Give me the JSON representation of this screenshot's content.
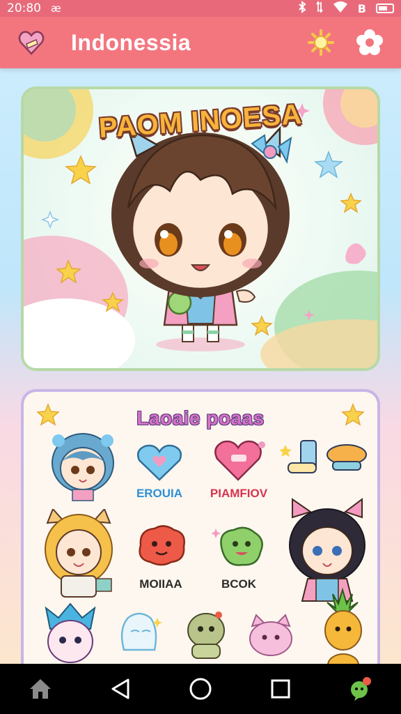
{
  "status_bar": {
    "time": "20:80",
    "notification_glyph": "æ",
    "carrier_glyph": "B"
  },
  "app_bar": {
    "title": "Indonessia",
    "left_icon": "heart-icon",
    "right_icons": [
      "sun-icon",
      "flower-settings-icon"
    ]
  },
  "hero": {
    "title": "PAOM INOESA"
  },
  "gallery": {
    "title": "Laoaie poaas",
    "stickers": [
      {
        "label": "EROUIA"
      },
      {
        "label": "PIAMFIOV"
      },
      {
        "label": "MOIIAA"
      },
      {
        "label": "BCOK"
      }
    ]
  },
  "nav_bar": {
    "buttons": [
      "home-icon",
      "back-icon",
      "home-circle-icon",
      "recents-icon",
      "assistant-icon"
    ]
  },
  "colors": {
    "status_bar": "#e86a7a",
    "app_bar": "#f3767f",
    "nav_bar": "#000000"
  }
}
